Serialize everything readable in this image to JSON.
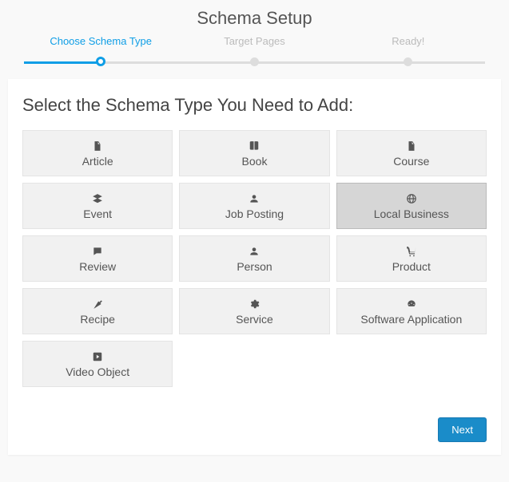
{
  "title": "Schema Setup",
  "steps": [
    {
      "label": "Choose Schema Type",
      "active": true
    },
    {
      "label": "Target Pages",
      "active": false
    },
    {
      "label": "Ready!",
      "active": false
    }
  ],
  "heading": "Select the Schema Type You Need to Add:",
  "tiles": [
    {
      "id": "article",
      "label": "Article",
      "icon": "file",
      "selected": false
    },
    {
      "id": "book",
      "label": "Book",
      "icon": "book",
      "selected": false
    },
    {
      "id": "course",
      "label": "Course",
      "icon": "file",
      "selected": false
    },
    {
      "id": "event",
      "label": "Event",
      "icon": "layers",
      "selected": false
    },
    {
      "id": "jobposting",
      "label": "Job Posting",
      "icon": "user",
      "selected": false
    },
    {
      "id": "localbusiness",
      "label": "Local Business",
      "icon": "globe",
      "selected": true
    },
    {
      "id": "review",
      "label": "Review",
      "icon": "comment",
      "selected": false
    },
    {
      "id": "person",
      "label": "Person",
      "icon": "user",
      "selected": false
    },
    {
      "id": "product",
      "label": "Product",
      "icon": "cart",
      "selected": false
    },
    {
      "id": "recipe",
      "label": "Recipe",
      "icon": "carrot",
      "selected": false
    },
    {
      "id": "service",
      "label": "Service",
      "icon": "gear",
      "selected": false
    },
    {
      "id": "software",
      "label": "Software Application",
      "icon": "dashboard",
      "selected": false
    },
    {
      "id": "video",
      "label": "Video Object",
      "icon": "play",
      "selected": false
    }
  ],
  "footer": {
    "next": "Next"
  }
}
